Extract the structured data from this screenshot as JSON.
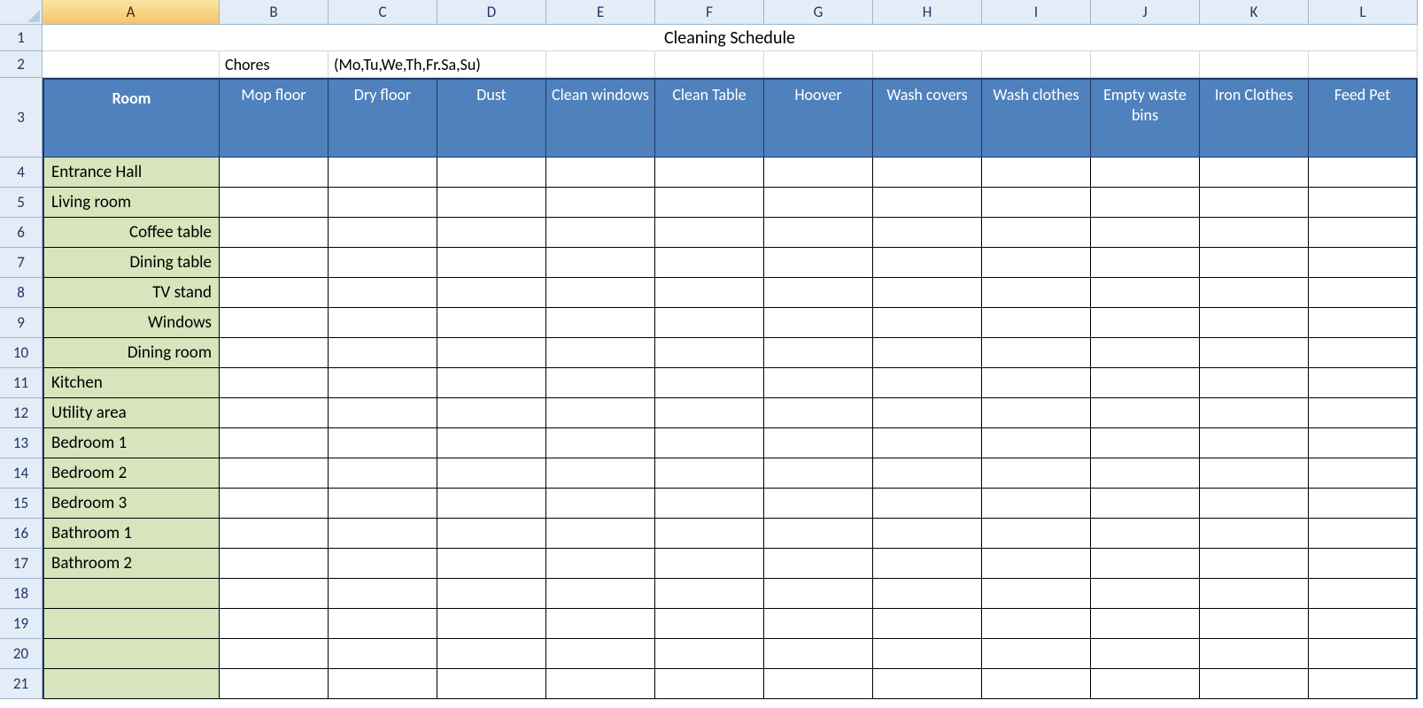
{
  "columns": [
    "A",
    "B",
    "C",
    "D",
    "E",
    "F",
    "G",
    "H",
    "I",
    "J",
    "K",
    "L"
  ],
  "active_column": "A",
  "row_numbers": [
    1,
    2,
    3,
    4,
    5,
    6,
    7,
    8,
    9,
    10,
    11,
    12,
    13,
    14,
    15,
    16,
    17,
    18,
    19,
    20,
    21
  ],
  "row1": {
    "title": "Cleaning Schedule"
  },
  "row2": {
    "B": "Chores",
    "C": "(Mo,Tu,We,Th,Fr.Sa,Su)"
  },
  "headers": {
    "A": "Room",
    "B": "Mop floor",
    "C": "Dry floor",
    "D": "Dust",
    "E": "Clean windows",
    "F": "Clean Table",
    "G": "Hoover",
    "H": "Wash covers",
    "I": "Wash clothes",
    "J": "Empty waste bins",
    "K": "Iron Clothes",
    "L": "Feed Pet"
  },
  "rooms": [
    {
      "label": "Entrance Hall",
      "indent": false
    },
    {
      "label": "Living room",
      "indent": false
    },
    {
      "label": "Coffee table",
      "indent": true
    },
    {
      "label": "Dining table",
      "indent": true
    },
    {
      "label": "TV stand",
      "indent": true
    },
    {
      "label": "Windows",
      "indent": true
    },
    {
      "label": "Dining room",
      "indent": true
    },
    {
      "label": "Kitchen",
      "indent": false
    },
    {
      "label": "Utility area",
      "indent": false
    },
    {
      "label": "Bedroom 1",
      "indent": false
    },
    {
      "label": "Bedroom 2",
      "indent": false
    },
    {
      "label": "Bedroom 3",
      "indent": false
    },
    {
      "label": "Bathroom 1",
      "indent": false
    },
    {
      "label": "Bathroom 2",
      "indent": false
    },
    {
      "label": "",
      "indent": false
    },
    {
      "label": "",
      "indent": false
    },
    {
      "label": "",
      "indent": false
    },
    {
      "label": "",
      "indent": false
    }
  ]
}
